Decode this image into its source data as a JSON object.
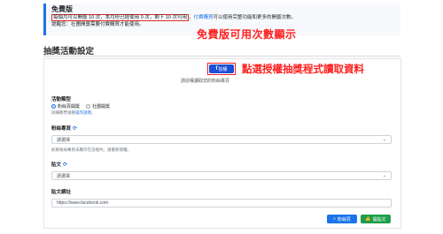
{
  "notice": {
    "title": "免費版",
    "line1_boxed": "每個月可以開獎 10 次，本月份已經使用 0 次，剩下 10 次可用",
    "line1_sep": "，",
    "line1_link": "付費購買",
    "line1_rest": "可以使用完整功能和更多的開獎次數。",
    "line2": "提醒您：社團開獎需要付費購買才能使用。"
  },
  "annotation_free": "免費版可用次數顯示",
  "section_title": "抽獎活動設定",
  "auth": {
    "icon": "facebook-icon",
    "button_label": "授權",
    "annotation": "點選授權抽獎程式讀取資料",
    "hint": "請授權讀取您的粉絲專頁"
  },
  "activity_type": {
    "label": "活動類型",
    "options": [
      "粉絲頁開獎",
      "社團開獎"
    ],
    "selected": "粉絲頁開獎",
    "help_prefix": "詳細教學請看",
    "help_link": "操作說明",
    "help_suffix": "。"
  },
  "fanpage": {
    "label": "粉絲專頁",
    "refresh_icon": "refresh-icon",
    "value": "請選擇",
    "help": "如果粉絲專頁未顯示在這裡內，請重新授權。"
  },
  "post": {
    "label": "貼文",
    "refresh_icon": "refresh-icon",
    "value": "請選擇"
  },
  "post_url": {
    "label": "貼文網址",
    "placeholder": "https://www.facebook.com"
  },
  "buttons": {
    "open_fanpage": "粉絲頁",
    "open_fanpage_icon": "search-icon",
    "open_post": "開貼文",
    "open_post_icon": "thumbs-up-icon"
  },
  "colors": {
    "accent": "#1a73e8",
    "annotation": "#ff1f1f",
    "success": "#1e9e4a"
  }
}
